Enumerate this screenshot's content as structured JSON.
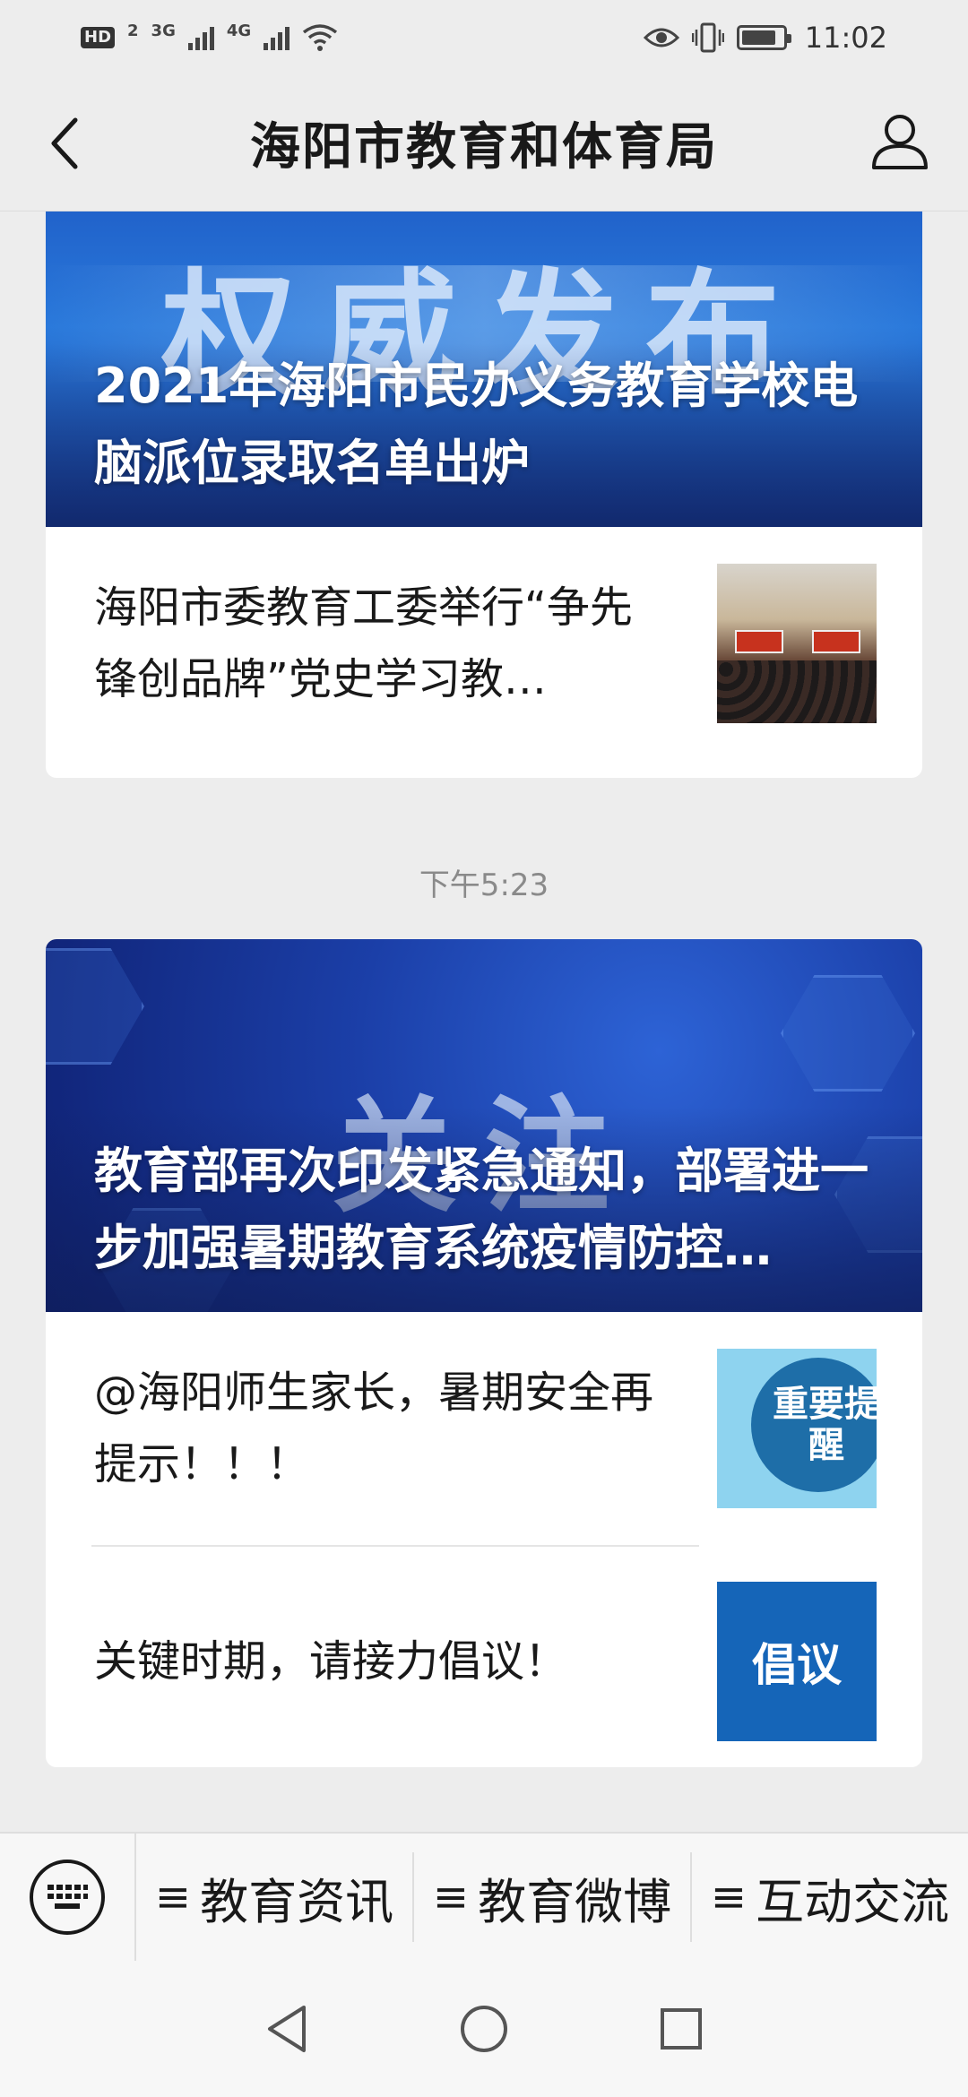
{
  "status_bar": {
    "hd": "HD",
    "sim_index": "2",
    "net1": "3G",
    "net2": "4G",
    "time": "11:02"
  },
  "header": {
    "title": "海阳市教育和体育局"
  },
  "feed": {
    "card1": {
      "cover_bg_text": "权威发布",
      "cover_title": "2021年海阳市民办义务教育学校电脑派位录取名单出炉",
      "items": [
        {
          "title": "海阳市委教育工委举行“争先锋创品牌”党史学习教…"
        }
      ]
    },
    "timestamp": "下午5:23",
    "card2": {
      "cover_bg_text": "关注",
      "cover_title": "教育部再次印发紧急通知，部署进一步加强暑期教育系统疫情防控…",
      "items": [
        {
          "title": "@海阳师生家长，暑期安全再提示！！！",
          "thumb_text": "重要提醒"
        },
        {
          "title": "关键时期，请接力倡议！",
          "thumb_text": "倡议"
        }
      ]
    }
  },
  "menu": {
    "items": [
      {
        "label": "教育资讯"
      },
      {
        "label": "教育微博"
      },
      {
        "label": "互动交流"
      }
    ]
  },
  "colors": {
    "background": "#ededed",
    "card": "#ffffff",
    "cover_blue": "#1b3fa8",
    "propose_blue": "#1565b8"
  }
}
